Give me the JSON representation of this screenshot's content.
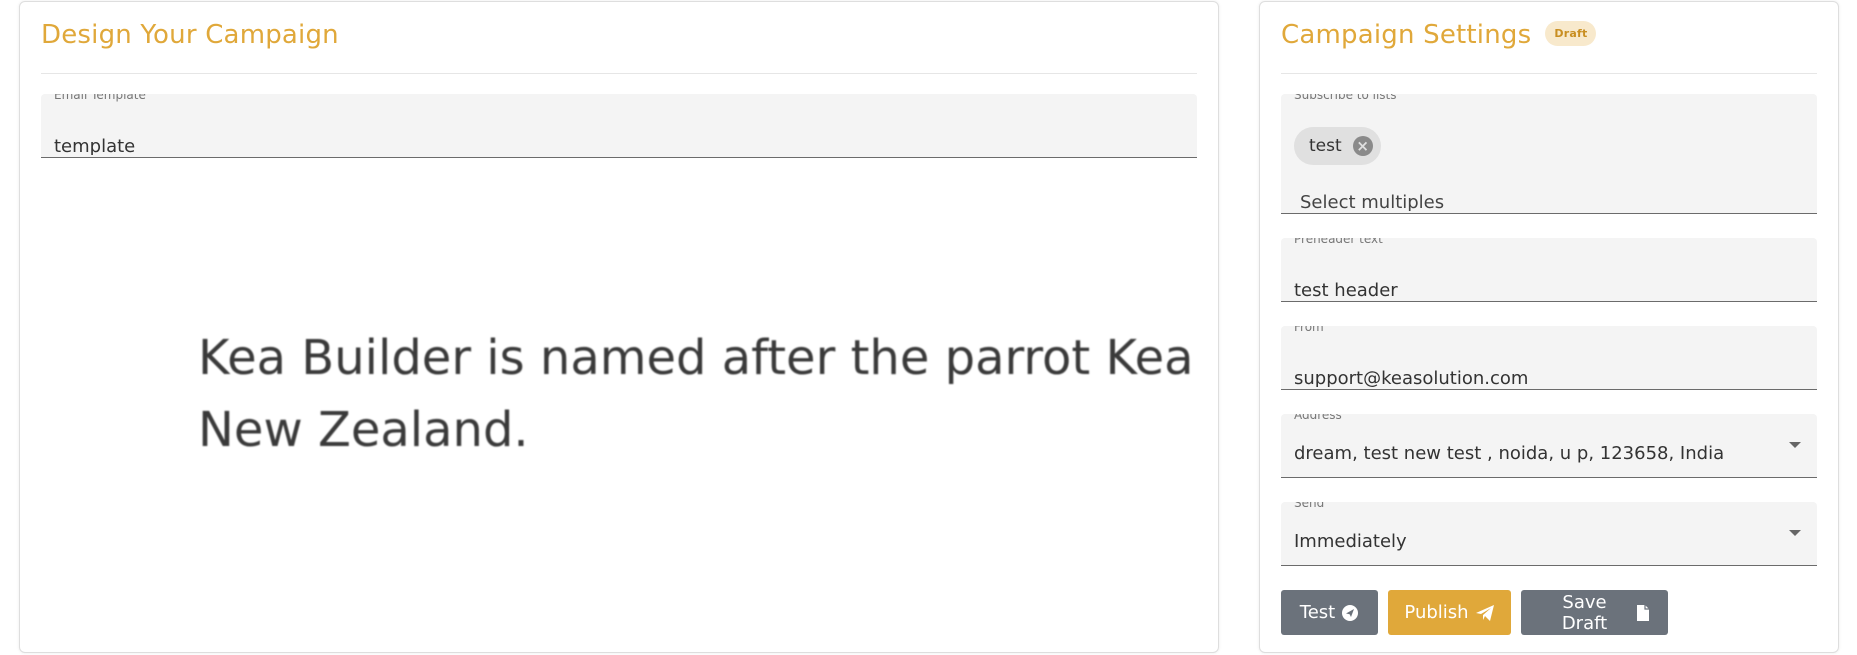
{
  "left": {
    "title": "Design Your Campaign",
    "template_field": {
      "label": "Email Template",
      "value": "template"
    },
    "preview": {
      "line1": "Kea Builder is named after the parrot Kea. K",
      "line2": "New Zealand."
    }
  },
  "right": {
    "title": "Campaign Settings",
    "badge": "Draft",
    "lists_field": {
      "label": "Subscribe to lists",
      "chips": [
        "test"
      ],
      "placeholder": "Select multiples"
    },
    "preheader_field": {
      "label": "Preheader text",
      "value": "test header"
    },
    "from_field": {
      "label": "From",
      "value": "support@keasolution.com"
    },
    "address_field": {
      "label": "Address",
      "value": "dream, test new test , noida, u p, 123658, India"
    },
    "send_field": {
      "label": "Send",
      "value": "Immediately"
    },
    "buttons": {
      "test": "Test",
      "publish": "Publish",
      "save_draft": "Save Draft"
    }
  },
  "colors": {
    "accent": "#e0a83a",
    "badge_bg": "#f8e9cc",
    "button_gray": "#6b727b",
    "field_bg": "#f4f4f4"
  },
  "icons": {
    "chip_remove": "close-circle-icon",
    "test": "send-circle-icon",
    "publish": "paper-plane-icon",
    "save_draft": "file-icon",
    "select": "chevron-down-icon"
  }
}
